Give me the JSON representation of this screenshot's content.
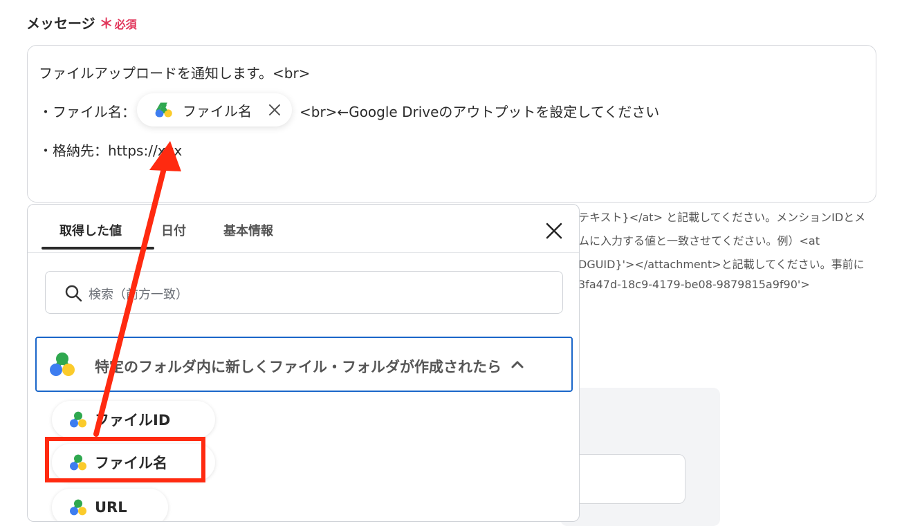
{
  "field": {
    "label": "メッセージ",
    "required_mark": "＊",
    "required_text": "必須"
  },
  "message": {
    "line1": "ファイルアップロードを通知します。<br>",
    "line2_prefix": "・ファイル名：",
    "chip_label": "ファイル名",
    "line2_suffix": "<br>←Google Driveのアウトプットを設定してください",
    "line3": "・格納先：https://xxx"
  },
  "hint_lines": [
    "テキスト}</at> と記載してください。メンションIDとメ",
    "ムに入力する値と一致させてください。例）<at",
    "DGUID}'></attachment>と記載してください。事前に",
    "3fa47d-18c9-4179-be08-9879815a9f90'>"
  ],
  "panel": {
    "tabs": [
      "取得した値",
      "日付",
      "基本情報"
    ],
    "search_placeholder": "検索（前方一致）",
    "group_title": "特定のフォルダ内に新しくファイル・フォルダが作成されたら",
    "items": [
      "ファイルID",
      "ファイル名",
      "URL"
    ]
  },
  "colors": {
    "accent_blue": "#1a66c9",
    "annotation_red": "#ff2a10",
    "required_pink": "#e1355a"
  },
  "icons": [
    "google-drive-icon",
    "close-icon",
    "search-icon",
    "chevron-up-icon"
  ]
}
